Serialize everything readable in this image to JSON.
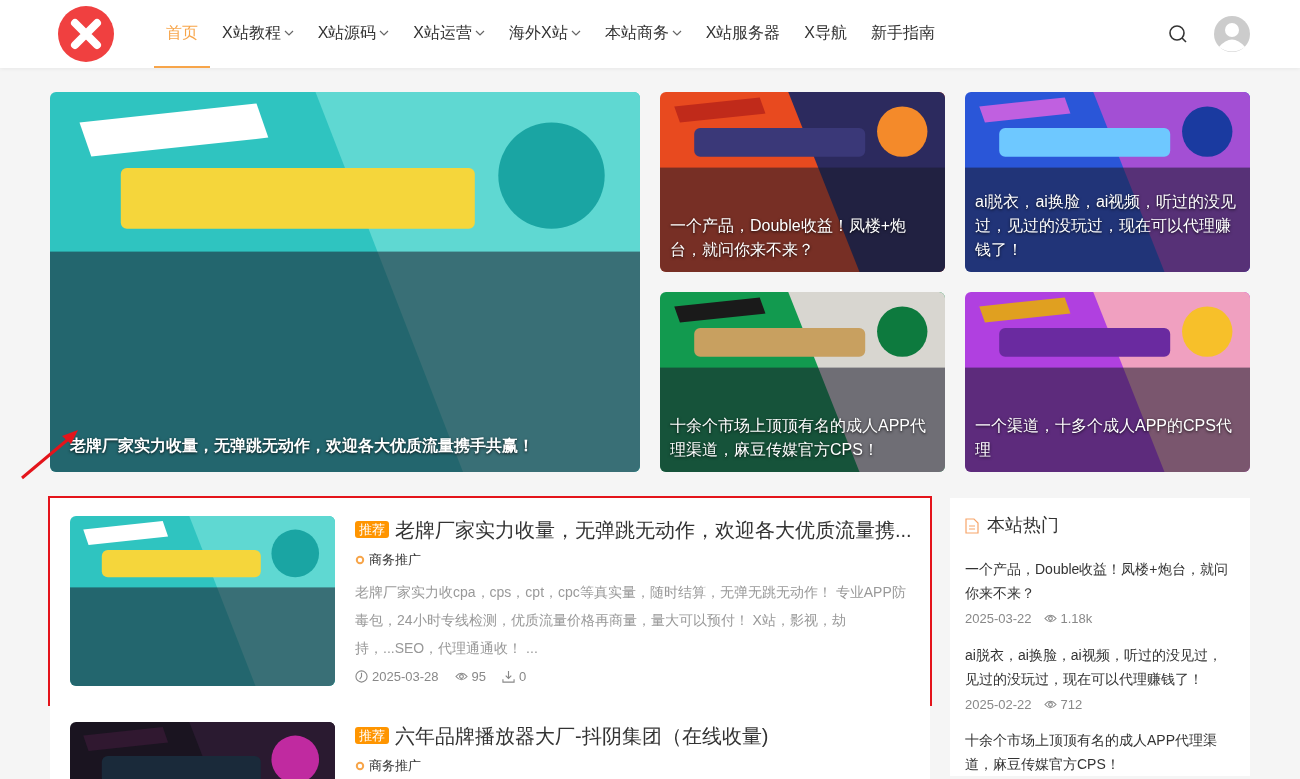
{
  "nav": {
    "items": [
      {
        "label": "首页",
        "selected": true,
        "dropdown": false
      },
      {
        "label": "X站教程",
        "selected": false,
        "dropdown": true
      },
      {
        "label": "X站源码",
        "selected": false,
        "dropdown": true
      },
      {
        "label": "X站运营",
        "selected": false,
        "dropdown": true
      },
      {
        "label": "海外X站",
        "selected": false,
        "dropdown": true
      },
      {
        "label": "本站商务",
        "selected": false,
        "dropdown": true
      },
      {
        "label": "X站服务器",
        "selected": false,
        "dropdown": false
      },
      {
        "label": "X导航",
        "selected": false,
        "dropdown": false
      },
      {
        "label": "新手指南",
        "selected": false,
        "dropdown": false
      }
    ]
  },
  "banners": [
    {
      "caption": "老牌厂家实力收量，无弹跳无动作，欢迎各大优质流量携手共赢！"
    },
    {
      "caption": "一个产品，Double收益！凤楼+炮台，就问你来不来？"
    },
    {
      "caption": "ai脱衣，ai换脸，ai视频，听过的没见过，见过的没玩过，现在可以代理赚钱了！"
    },
    {
      "caption": "十余个市场上顶顶有名的成人APP代理渠道，麻豆传媒官方CPS！"
    },
    {
      "caption": "一个渠道，十多个成人APP的CPS代理"
    }
  ],
  "posts": [
    {
      "badge": "推荐",
      "title": "老牌厂家实力收量，无弹跳无动作，欢迎各大优质流量携...",
      "category": "商务推广",
      "excerpt": "老牌厂家实力收cpa，cps，cpt，cpc等真实量，随时结算，无弹无跳无动作！ 专业APP防毒包，24小时专线检测，优质流量价格再商量，量大可以预付！ X站，影视，劫持，...SEO，代理通通收！ ...",
      "date": "2025-03-28",
      "views": "95",
      "downloads": "0",
      "highlighted": true
    },
    {
      "badge": "推荐",
      "title": "六年品牌播放器大厂-抖阴集团（在线收量)",
      "category": "商务推广",
      "highlighted": false
    }
  ],
  "sidebar": {
    "title": "本站热门",
    "items": [
      {
        "title": "一个产品，Double收益！凤楼+炮台，就问你来不来？",
        "date": "2025-03-22",
        "views": "1.18k"
      },
      {
        "title": "ai脱衣，ai换脸，ai视频，听过的没见过，见过的没玩过，现在可以代理赚钱了！",
        "date": "2025-02-22",
        "views": "712"
      },
      {
        "title": "十余个市场上顶顶有名的成人APP代理渠道，麻豆传媒官方CPS！"
      }
    ]
  }
}
